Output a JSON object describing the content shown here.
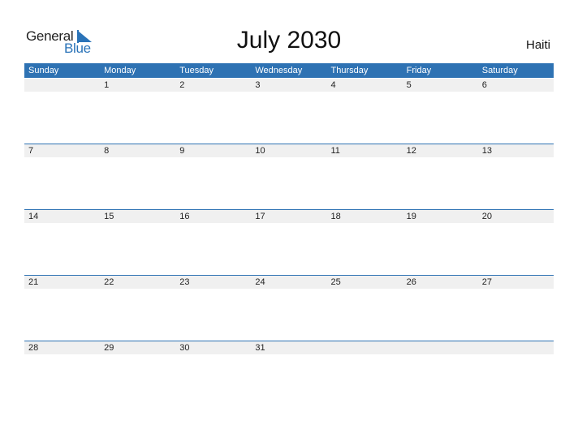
{
  "logo": {
    "line1": "General",
    "line2": "Blue"
  },
  "title": "July 2030",
  "country": "Haiti",
  "colors": {
    "accent": "#2e72b3",
    "row_bg": "#f0f0f0"
  },
  "weekdays": [
    "Sunday",
    "Monday",
    "Tuesday",
    "Wednesday",
    "Thursday",
    "Friday",
    "Saturday"
  ],
  "weeks": [
    [
      "",
      "1",
      "2",
      "3",
      "4",
      "5",
      "6"
    ],
    [
      "7",
      "8",
      "9",
      "10",
      "11",
      "12",
      "13"
    ],
    [
      "14",
      "15",
      "16",
      "17",
      "18",
      "19",
      "20"
    ],
    [
      "21",
      "22",
      "23",
      "24",
      "25",
      "26",
      "27"
    ],
    [
      "28",
      "29",
      "30",
      "31",
      "",
      "",
      ""
    ]
  ]
}
